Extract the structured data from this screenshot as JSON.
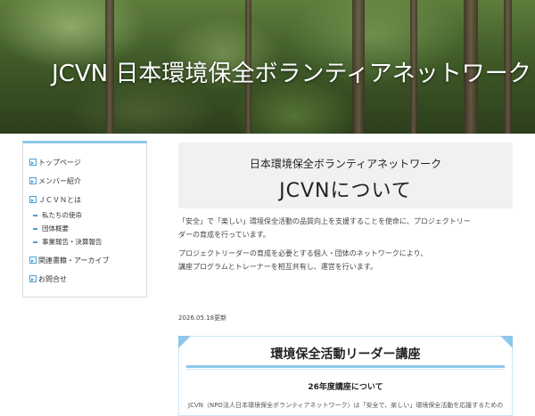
{
  "header": {
    "title": "JCVN 日本環境保全ボランティアネットワーク"
  },
  "sidebar": {
    "items": [
      {
        "label": "トップページ"
      },
      {
        "label": "メンバー紹介"
      },
      {
        "label": "ＪＣＶＮとは",
        "children": [
          {
            "label": "私たちの使命"
          },
          {
            "label": "団体概要"
          },
          {
            "label": "事業報告・決算報告"
          }
        ]
      },
      {
        "label": "関連書籍・アーカイブ"
      },
      {
        "label": "お問合せ"
      }
    ]
  },
  "main": {
    "title_sub": "日本環境保全ボランティアネットワーク",
    "title_main": "JCVNについて",
    "paragraph1_line1": "「安全」で「楽しい」環境保全活動の品質向上を支援することを使命に、プロジェクトリー",
    "paragraph1_line2": "ダーの育成を行っています。",
    "paragraph2_line1": "プロジェクトリーダーの育成を必要とする個人・団体のネットワークにより、",
    "paragraph2_line2": "講座プログラムとトレーナーを相互共有し、運営を行います。",
    "updated": "2026.05.18更新"
  },
  "card": {
    "title": "環境保全活動リーダー講座",
    "subtitle": "26年度講座について",
    "body": "JCVN（NPO法人日本環境保全ボランティアネットワーク）は「安全で、楽しい」環境保全活動を応援するための"
  },
  "colors": {
    "accent": "#8cc8ea",
    "nav_icon": "#4a9ed6",
    "title_bg": "#f1f1f1"
  }
}
